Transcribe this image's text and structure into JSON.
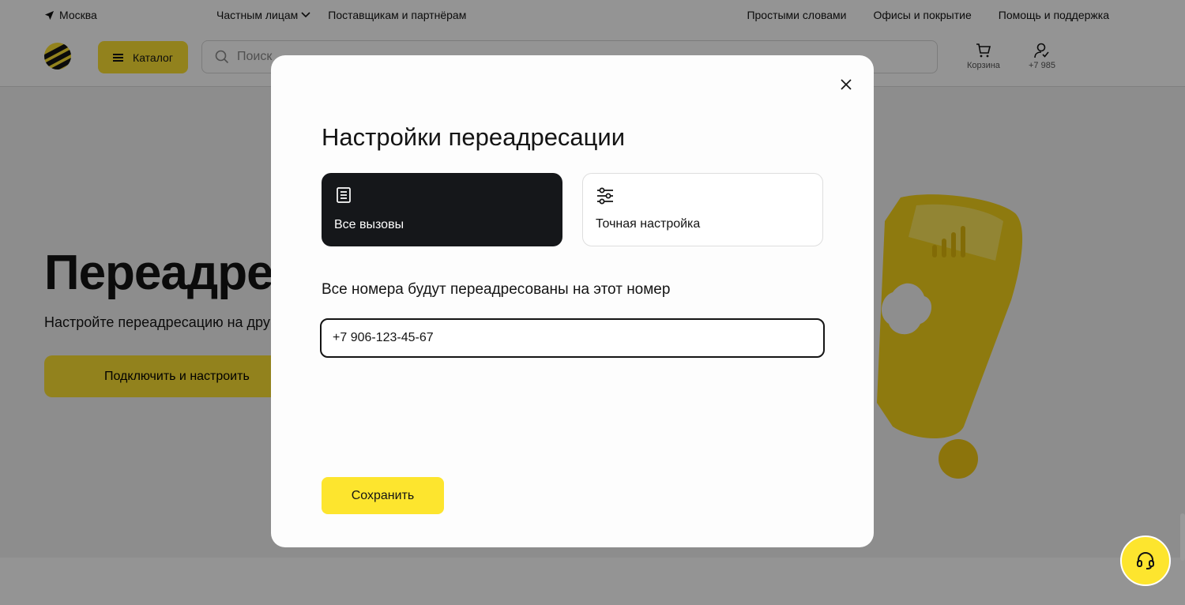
{
  "topbar": {
    "city": "Москва",
    "left_links": [
      "Частным лицам",
      "Поставщикам и партнёрам"
    ],
    "right_links": [
      "Простыми словами",
      "Офисы и покрытие",
      "Помощь и поддержка"
    ]
  },
  "header": {
    "catalog_label": "Каталог",
    "search_placeholder": "Поиск",
    "cart_label": "Корзина",
    "profile_label": "+7 985"
  },
  "hero": {
    "title": "Переадресация",
    "subtitle": "Настройте переадресацию на другой номер",
    "cta_label": "Подключить и настроить"
  },
  "modal": {
    "title": "Настройки переадресации",
    "options": [
      {
        "label": "Все вызовы",
        "icon": "document-icon",
        "selected": true
      },
      {
        "label": "Точная настройка",
        "icon": "sliders-icon",
        "selected": false
      }
    ],
    "field_label": "Все номера будут переадресованы на этот номер",
    "phone_value": "+7 906-123-45-67",
    "save_label": "Сохранить"
  },
  "colors": {
    "brand_yellow": "#fde52e",
    "selected_card": "#15171a",
    "overlay": "rgba(0,0,0,0.42)"
  }
}
